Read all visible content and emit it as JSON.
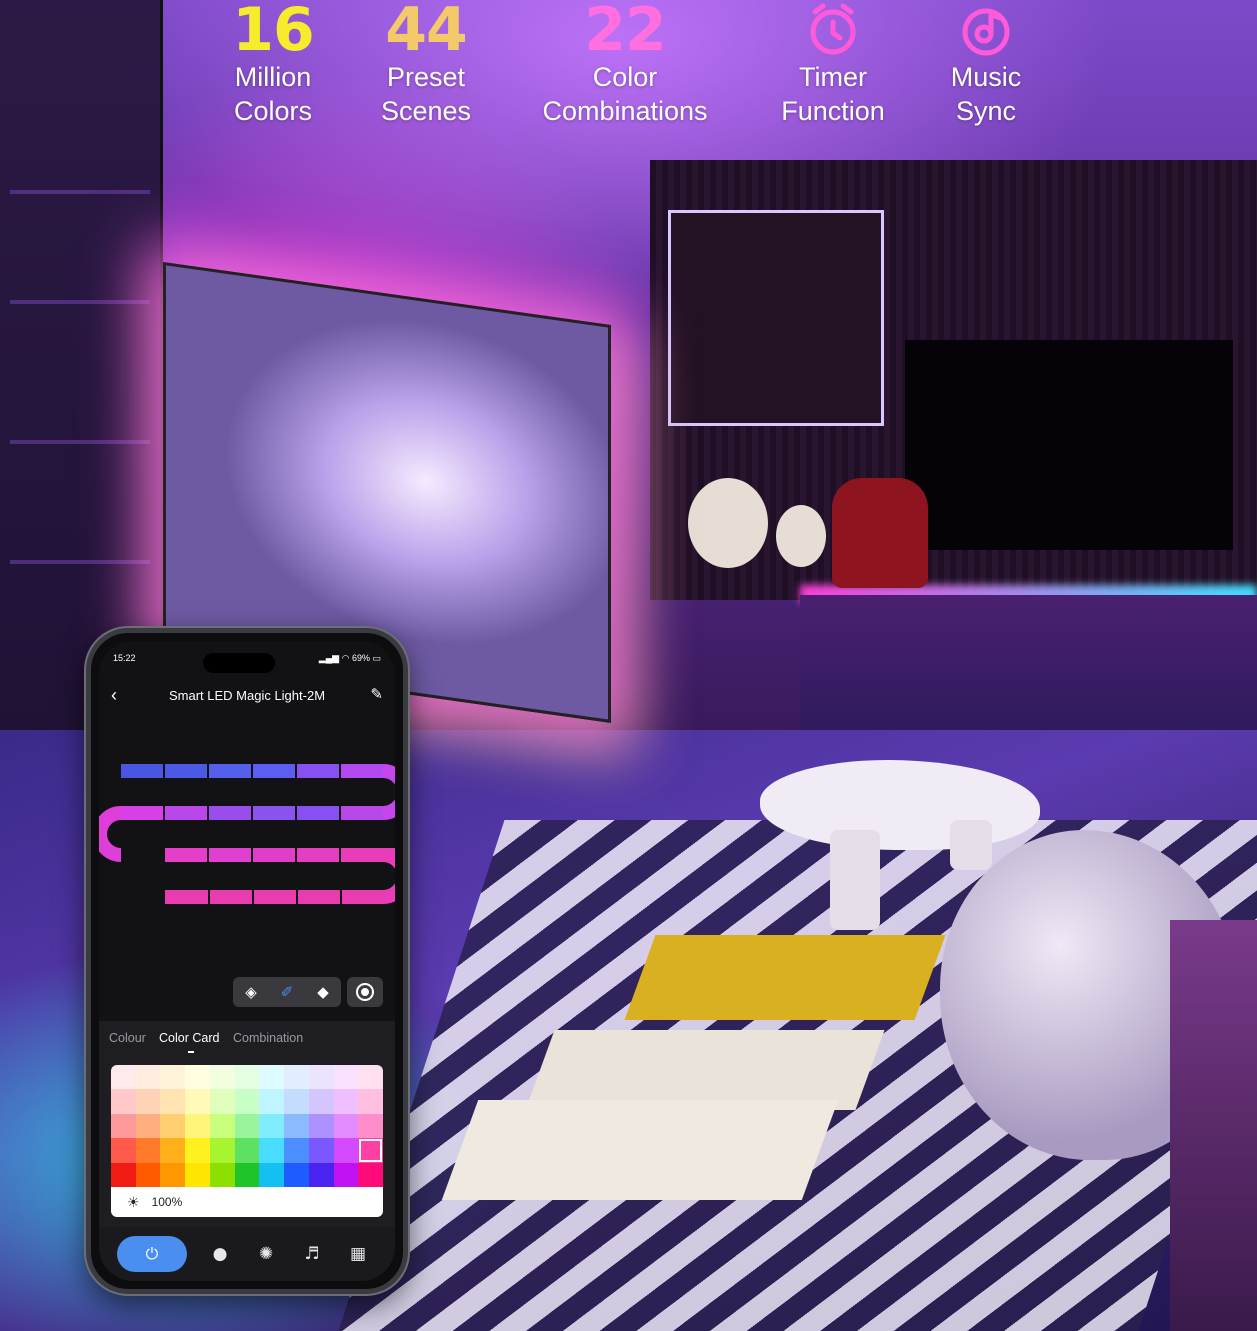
{
  "features": [
    {
      "number": "16",
      "line1": "Million",
      "line2": "Colors",
      "color": "#f7ec2c"
    },
    {
      "number": "44",
      "line1": "Preset",
      "line2": "Scenes",
      "color": "#f3c96a"
    },
    {
      "number": "22",
      "line1": "Color",
      "line2": "Combinations",
      "color": "#ff6fe0"
    },
    {
      "icon": "alarm-clock-icon",
      "line1": "Timer",
      "line2": "Function",
      "color": "#ff5ad9"
    },
    {
      "icon": "music-disc-icon",
      "line1": "Music",
      "line2": "Sync",
      "color": "#ff5ad9"
    }
  ],
  "phone": {
    "status": {
      "time": "15:22",
      "battery": "69%"
    },
    "nav": {
      "title": "Smart LED Magic Light-2M"
    },
    "tabs": [
      "Colour",
      "Color Card",
      "Combination"
    ],
    "active_tab": "Color Card",
    "brightness": "100%",
    "strip_colors": {
      "row1": [
        "#4a55e0",
        "#4c58e6",
        "#5560ea",
        "#5b5ef0",
        "#8a4ff0",
        "#b24af0"
      ],
      "row2": [
        "#d540e8",
        "#b947ea",
        "#9a4cec",
        "#8b52ee",
        "#8850f0",
        "#b848e8"
      ],
      "row3": [
        "#e53ec8",
        "#e040d0",
        "#e03ec8",
        "#e53ec0",
        "#e83cb8",
        "#e840b0"
      ]
    },
    "palette": [
      [
        "#ffe9ea",
        "#ffecdf",
        "#fff3da",
        "#fffde0",
        "#f1ffe0",
        "#e4ffe4",
        "#e0fbff",
        "#e2eeff",
        "#ece4ff",
        "#f9e0ff",
        "#ffe0f0"
      ],
      [
        "#ffc9c9",
        "#ffd3b8",
        "#ffe3b0",
        "#fffab8",
        "#e1ffbc",
        "#c8ffc7",
        "#bff5ff",
        "#c3dcff",
        "#d4c5ff",
        "#f0bfff",
        "#ffbfe0"
      ],
      [
        "#ff9a9a",
        "#ffae80",
        "#ffce70",
        "#fff57a",
        "#c9ff7c",
        "#98f59c",
        "#82ecff",
        "#8cbaff",
        "#ad92ff",
        "#e48cff",
        "#ff8ccb"
      ],
      [
        "#ff5a4a",
        "#ff7a2a",
        "#ffb01a",
        "#fff020",
        "#a6f530",
        "#5ee063",
        "#48dcff",
        "#4c8dff",
        "#7a57ff",
        "#d44aff",
        "#ff3fa4"
      ],
      [
        "#f21b14",
        "#ff5a00",
        "#ff9800",
        "#ffe600",
        "#8be000",
        "#1fc42a",
        "#13c0f0",
        "#1f5cff",
        "#4a23f0",
        "#c012f0",
        "#ff0a7a"
      ]
    ],
    "selected_cell": {
      "row": 3,
      "col": 10
    },
    "accent": "#4a8ef0"
  }
}
